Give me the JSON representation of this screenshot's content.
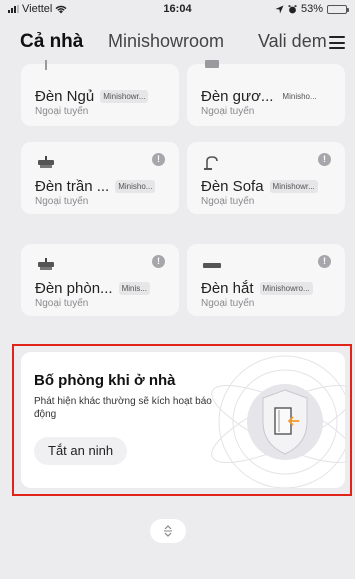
{
  "status_bar": {
    "carrier": "Viettel",
    "time": "16:04",
    "battery_percent": "53%",
    "battery_level": 0.53
  },
  "tabs": [
    {
      "label": "Cả nhà",
      "active": true
    },
    {
      "label": "Minishowroom",
      "active": false
    },
    {
      "label": "Vali dem",
      "active": false
    }
  ],
  "devices": [
    {
      "name": "Đèn Ngủ",
      "room": "Minishowr...",
      "status": "Ngoại tuyến",
      "icon": "lamp-icon"
    },
    {
      "name": "Đèn gươ...",
      "room": "Minisho...",
      "status": "Ngoại tuyến",
      "icon": "mirror-light-icon"
    },
    {
      "name": "Đèn trần ...",
      "room": "Minisho...",
      "status": "Ngoại tuyến",
      "icon": "ceiling-light-icon"
    },
    {
      "name": "Đèn Sofa",
      "room": "Minishowr...",
      "status": "Ngoại tuyến",
      "icon": "floor-lamp-icon"
    },
    {
      "name": "Đèn phòn...",
      "room": "Minis...",
      "status": "Ngoại tuyến",
      "icon": "ceiling-light-icon"
    },
    {
      "name": "Đèn hắt",
      "room": "Minishowro...",
      "status": "Ngoại tuyến",
      "icon": "strip-light-icon"
    }
  ],
  "security": {
    "title": "Bố phòng khi ở nhà",
    "description": "Phát hiện khác thường sẽ kích hoạt báo động",
    "button_label": "Tắt an ninh",
    "accent_color": "#f29b2f"
  },
  "colors": {
    "background": "#ececee",
    "highlight_border": "#e0241b",
    "warning_badge": "#a7a7ab"
  }
}
